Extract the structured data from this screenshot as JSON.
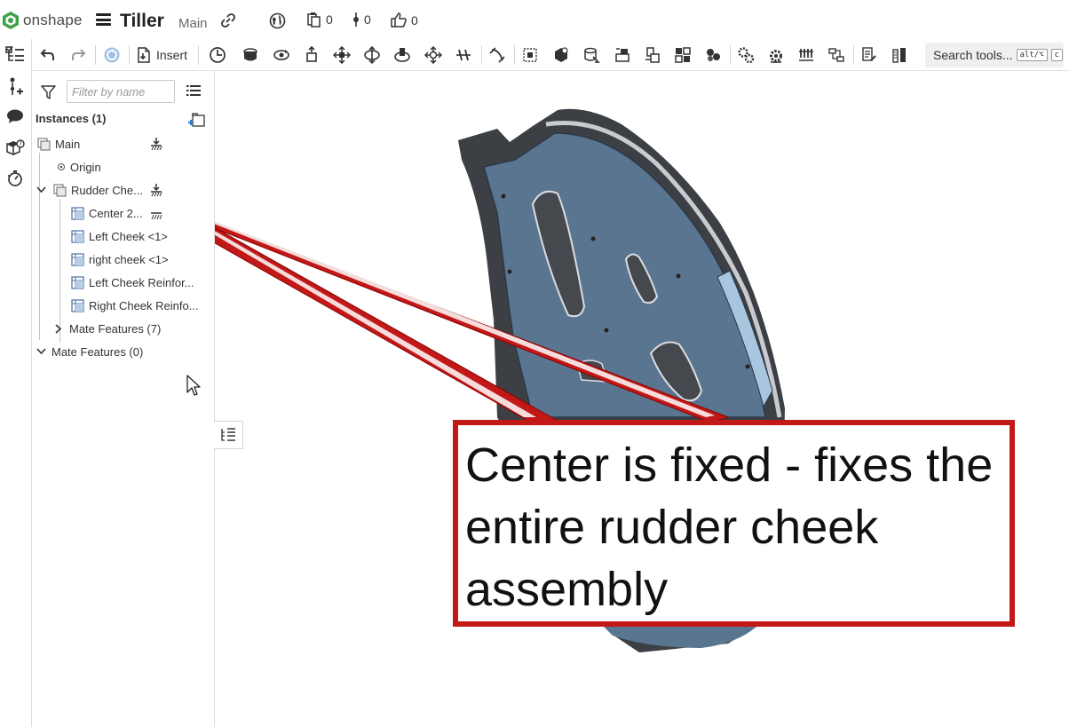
{
  "app": {
    "brand": "onshape",
    "document_title": "Tiller",
    "workspace": "Main",
    "colors": {
      "brand_green": "#3fa14a",
      "accent_blue": "#2c7bd6",
      "callout_red": "#c21818",
      "part_blue": "#5a7590",
      "part_dark": "#3c3f44"
    },
    "icons": [
      "hamburger-icon",
      "link-icon",
      "globe-icon",
      "versions-icon",
      "branch-icon",
      "like-icon"
    ]
  },
  "header": {
    "versions_count": "0",
    "branches_count": "0",
    "likes_count": "0"
  },
  "rail": {
    "items": [
      "feature-list-icon",
      "mates-icon",
      "comments-icon",
      "bom-icon",
      "animation-icon"
    ]
  },
  "toolbar": {
    "insert_label": "Insert",
    "search_label": "Search tools...",
    "search_shortcut_1": "alt/⌥",
    "search_shortcut_2": "c",
    "tools": [
      "undo-icon",
      "redo-icon",
      "update-icon",
      "insert-icon",
      "named-position-icon",
      "fastened-mate-icon",
      "revolute-mate-icon",
      "slider-mate-icon",
      "planar-mate-icon",
      "cylindrical-mate-icon",
      "pin-slot-mate-icon",
      "ball-mate-icon",
      "parallel-mate-icon",
      "tangent-mate-icon",
      "mate-connector-icon",
      "group-icon",
      "replicate-icon",
      "relation-icon",
      "gear-relation-icon",
      "rack-pinion-icon",
      "screw-relation-icon",
      "linear-relation-icon",
      "explode-icon",
      "layout-icon",
      "pattern-icon",
      "mate-values-icon",
      "measure-icon",
      "section-view-icon",
      "named-views-icon"
    ]
  },
  "panel": {
    "filter_placeholder": "Filter by name",
    "instances_header": "Instances (1)",
    "tree": {
      "main": "Main",
      "origin": "Origin",
      "rudder": "Rudder Che...",
      "center": "Center 2...",
      "left_cheek": "Left Cheek <1>",
      "right_cheek": "right cheek <1>",
      "left_reinforcement": "Left Cheek Reinfor...",
      "right_reinforcement": "Right Cheek Reinfo...",
      "sub_mates": "Mate Features (7)",
      "mates": "Mate Features (0)"
    }
  },
  "callout": {
    "text": "Center is fixed - fixes the entire rudder cheek assembly"
  }
}
